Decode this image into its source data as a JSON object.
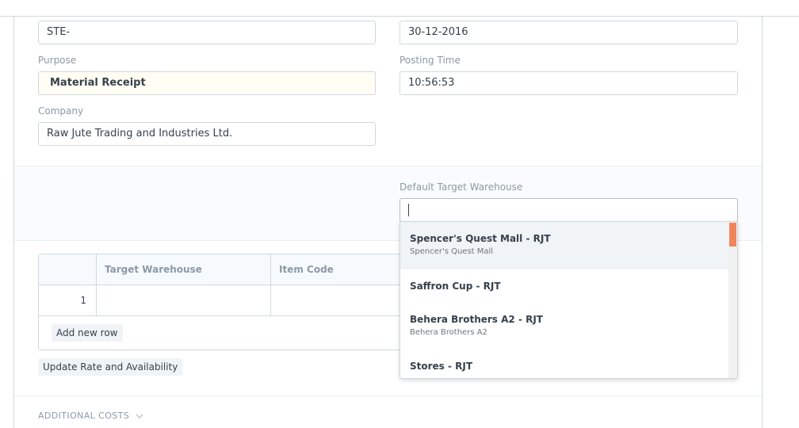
{
  "form": {
    "series_value": "STE-",
    "posting_date_value": "30-12-2016",
    "purpose_label": "Purpose",
    "purpose_value": "Material Receipt",
    "posting_time_label": "Posting Time",
    "posting_time_value": "10:56:53",
    "company_label": "Company",
    "company_value": "Raw Jute Trading and Industries Ltd.",
    "default_target_warehouse_label": "Default Target Warehouse",
    "default_target_warehouse_value": ""
  },
  "dropdown": {
    "items": [
      {
        "title": "Spencer's Quest Mall - RJT",
        "subtitle": "Spencer's Quest Mall"
      },
      {
        "title": "Saffron Cup - RJT",
        "subtitle": ""
      },
      {
        "title": "Behera Brothers A2 - RJT",
        "subtitle": "Behera Brothers A2"
      },
      {
        "title": "Stores - RJT",
        "subtitle": ""
      }
    ],
    "scrollbar_color": "#f0855c"
  },
  "items_table": {
    "columns": [
      "",
      "Target Warehouse",
      "Item Code"
    ],
    "rows": [
      {
        "idx": "1",
        "target_warehouse": "",
        "item_code": ""
      }
    ],
    "add_row_label": "Add new row"
  },
  "update_rate_label": "Update Rate and Availability",
  "additional_costs": {
    "title": "ADDITIONAL COSTS",
    "icon": "chevron-down-icon"
  }
}
